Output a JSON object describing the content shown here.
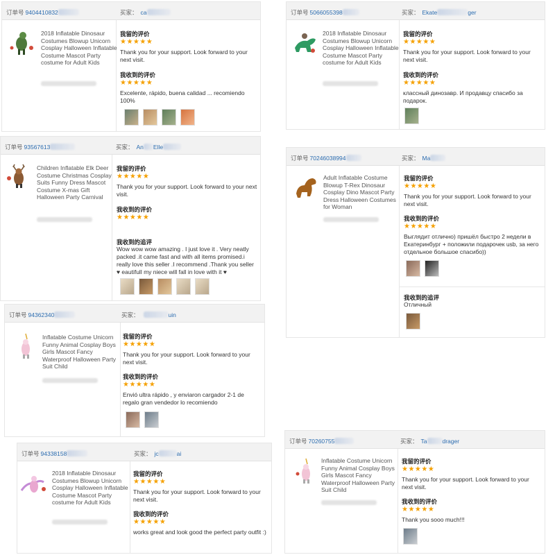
{
  "labels": {
    "order_prefix": "订单号",
    "buyer_prefix": "买家：",
    "my_review": "我留的评价",
    "received_review": "我收到的评价",
    "follow_up": "我收到的追评",
    "stars": "★★★★★"
  },
  "cards": [
    {
      "order_no": "9404410832",
      "buyer": "ca",
      "product": "2018 Inflatable Dinosaur Costumes Blowup Unicorn Cosplay Halloween Inflatable Costume Mascot Party costume for Adult Kids",
      "my_review": "Thank you for your support. Look forward to your next visit.",
      "received_review": "Excelente, rápido, buena calidad ... recomiendo 100%"
    },
    {
      "order_no": "5066055398",
      "buyer": "Ekate",
      "buyer_tail": "ger",
      "product": "2018 Inflatable Dinosaur Costumes Blowup Unicorn Cosplay Halloween Inflatable Costume Mascot Party costume for Adult Kids",
      "my_review": "Thank you for your support. Look forward to your next visit.",
      "received_review": "классный динозавр. И продавцу спасибо за подарок."
    },
    {
      "order_no": "93567613",
      "buyer": "An",
      "buyer_tail": "Elle",
      "product": "Children Inflatable Elk Deer Costume Christmas Cosplay Suits Funny Dress Mascot Costume X-mas Gift Halloween Party Carnival",
      "my_review": "Thank you for your support. Look forward to your next visit.",
      "follow_up": "Wow wow wow amazing . I just love it . Very neatly packed .it came fast and with all items promised.i really love this seller .I recommend .Thank you seller ♥ eautifull my niece will fall in love with it ♥"
    },
    {
      "order_no": "70246038994",
      "buyer": "Ma",
      "product": "Adult Inflatable Costume Blowup T-Rex Dinosaur Cosplay Dino Mascot Party Dress Halloween Costumes for Woman",
      "my_review": "Thank you for your support. Look forward to your next visit.",
      "received_review": "Выглядит отлично) пришёл быстро 2 недели в Екатеринбург + положили подарочек usb, за него отдельное большое спасибо))",
      "follow_up": "Отличный"
    },
    {
      "order_no": "94362340",
      "buyer_tail": "uin",
      "product": "Inflatable Costume Unicorn Funny Animal Cosplay Boys Girls Mascot Fancy Waterproof Halloween Party Suit Child",
      "my_review": "Thank you for your support. Look forward to your next visit.",
      "received_review": "Envió ultra rápido , y enviaron cargador 2-1 de regalo gran vendedor lo recomiendo"
    },
    {
      "order_no": "94338158",
      "buyer": "jc",
      "buyer_tail": "ai",
      "product": "2018 Inflatable Dinosaur Costumes Blowup Unicorn Cosplay Halloween Inflatable Costume Mascot Party costume for Adult Kids",
      "my_review": "Thank you for your support. Look forward to your next visit.",
      "received_review": "works great and look good the perfect party outfit :)"
    },
    {
      "order_no": "70260755",
      "buyer": "Ta",
      "buyer_tail": "drager",
      "product": "Inflatable Costume Unicorn Funny Animal Cosplay Boys Girls Mascot Fancy Waterproof Halloween Party Suit Child",
      "my_review": "Thank you for your support. Look forward to your next visit.",
      "received_review": "Thank you sooo much!!!"
    }
  ]
}
